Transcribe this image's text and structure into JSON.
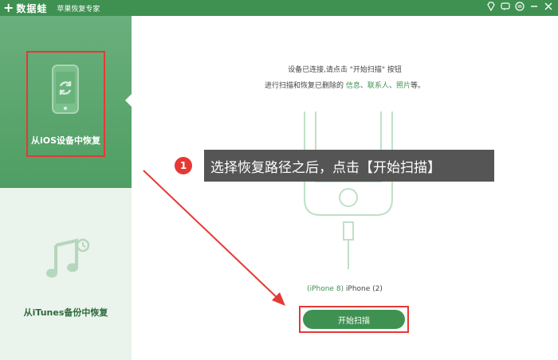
{
  "titlebar": {
    "logo_plus": "+",
    "logo_name": "数据蛙",
    "app_title": "苹果恢复专家"
  },
  "sidebar": {
    "items": [
      {
        "label": "从iOS设备中恢复",
        "active": true,
        "icon": "phone-refresh-icon"
      },
      {
        "label": "从iTunes备份中恢复",
        "active": false,
        "icon": "music-restore-icon"
      }
    ]
  },
  "main": {
    "instruction_line1": "设备已连接,请点击 \"开始扫描\" 按钮",
    "instruction_line2_prefix": "进行扫描和恢复已删除的 ",
    "instruction_hl1": "信息",
    "instruction_sep1": "、",
    "instruction_hl2": "联系人",
    "instruction_sep2": "、",
    "instruction_hl3": "照片",
    "instruction_suffix": "等。",
    "device_model": "(iPhone 8)",
    "device_name": " iPhone (2)",
    "start_button": "开始扫描"
  },
  "annotation": {
    "number": "1",
    "text": "选择恢复路径之后，点击【开始扫描】"
  },
  "colors": {
    "brand": "#3f9152",
    "highlight": "#e53935",
    "sidebar_bg": "#eaf3ec"
  }
}
